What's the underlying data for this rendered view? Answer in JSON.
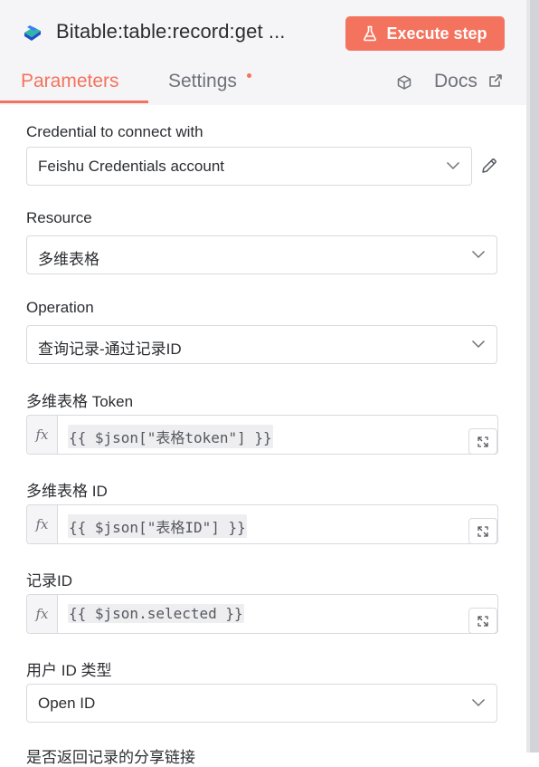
{
  "header": {
    "node_title": "Bitable:table:record:get ...",
    "execute_label": "Execute step",
    "tabs": [
      {
        "label": "Parameters"
      },
      {
        "label": "Settings"
      },
      {
        "label": "Docs"
      }
    ]
  },
  "fields": {
    "credential": {
      "label": "Credential to connect with",
      "value": "Feishu Credentials account"
    },
    "resource": {
      "label": "Resource",
      "value": "多维表格"
    },
    "operation": {
      "label": "Operation",
      "value": "查询记录-通过记录ID"
    },
    "bitable_token": {
      "label": "多维表格 Token",
      "fx": "fx",
      "expression": "{{ $json[\"表格token\"] }}"
    },
    "bitable_id": {
      "label": "多维表格 ID",
      "fx": "fx",
      "expression": "{{ $json[\"表格ID\"] }}"
    },
    "record_id": {
      "label": "记录ID",
      "fx": "fx",
      "expression": "{{ $json.selected }}"
    },
    "user_id_type": {
      "label": "用户 ID 类型",
      "value": "Open ID"
    },
    "share_link": {
      "label": "是否返回记录的分享链接"
    }
  },
  "colors": {
    "accent": "#f4735e",
    "header_bg": "#f5f5f7",
    "border": "#d9dadf"
  },
  "icons": [
    "bitable-app-logo",
    "flask-icon",
    "cube-icon",
    "external-link-icon",
    "chevron-down-icon",
    "pencil-icon",
    "expand-icon"
  ]
}
